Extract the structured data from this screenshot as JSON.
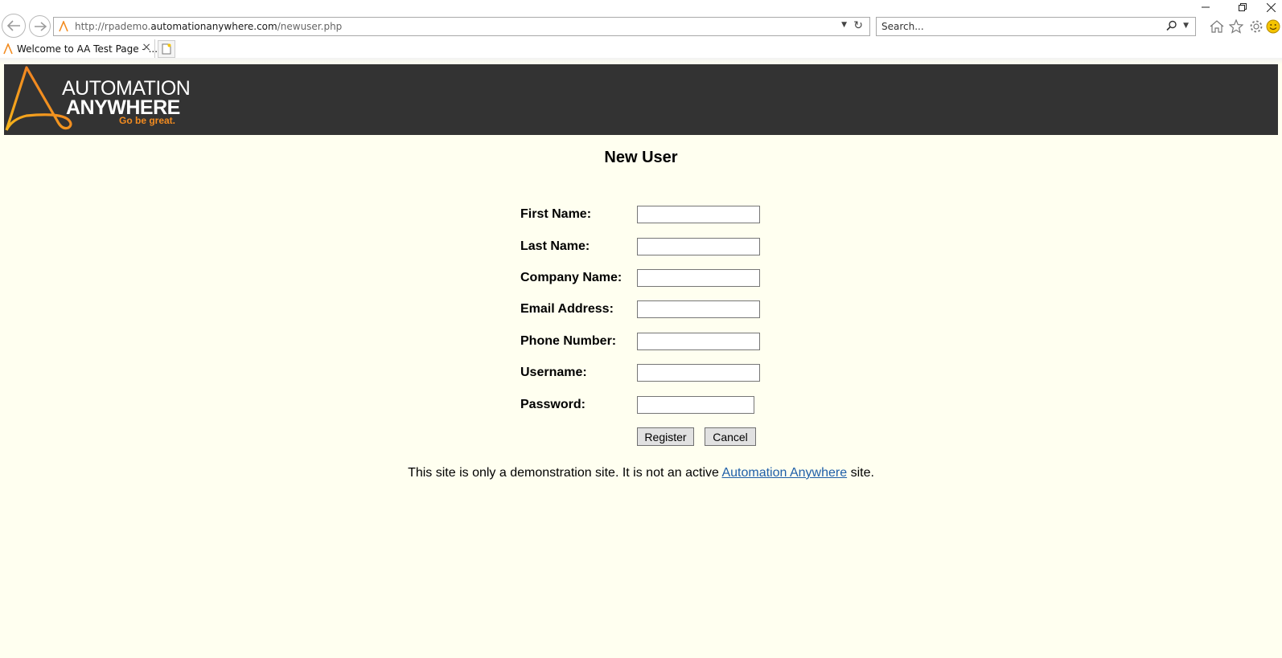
{
  "browser": {
    "url_prefix": "http://rpademo.",
    "url_domain": "automationanywhere.com",
    "url_path": "/newuser.php",
    "search_placeholder": "Search...",
    "tab_title": "Welcome to AA Test Page - ...",
    "tab_close": "×",
    "icons": [
      "back-arrow-icon",
      "forward-arrow-icon",
      "site-favicon",
      "dropdown-arrow-icon",
      "refresh-icon",
      "search-icon",
      "home-icon",
      "favorites-star-icon",
      "settings-gear-icon",
      "smiley-feedback-icon",
      "minimize-icon",
      "restore-icon",
      "close-icon",
      "new-tab-icon"
    ]
  },
  "header": {
    "logo_line1": "AUTOMATION",
    "logo_line2": "ANYWHERE",
    "tagline": "Go be great.",
    "banner_color": "#333333",
    "accent_color": "#f28b20"
  },
  "form": {
    "title": "New User",
    "fields": [
      {
        "label": "First Name:",
        "value": ""
      },
      {
        "label": "Last Name:",
        "value": ""
      },
      {
        "label": "Company Name:",
        "value": ""
      },
      {
        "label": "Email Address:",
        "value": ""
      },
      {
        "label": "Phone Number:",
        "value": ""
      },
      {
        "label": "Username:",
        "value": ""
      },
      {
        "label": "Password:",
        "value": ""
      }
    ],
    "register_label": "Register",
    "cancel_label": "Cancel"
  },
  "notice": {
    "text_before": "This site is only a demonstration site. It is not an active ",
    "link_text": "Automation Anywhere",
    "text_after": " site."
  },
  "page_background": "#fffff0"
}
